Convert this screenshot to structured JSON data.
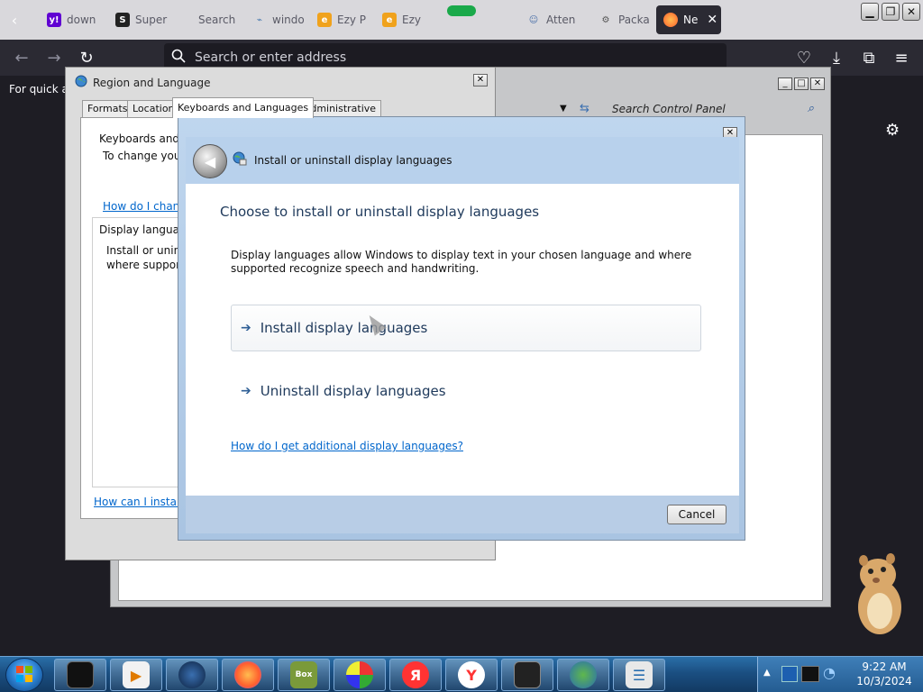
{
  "browser": {
    "tabs": [
      {
        "label": "down",
        "icon": "yahoo-icon"
      },
      {
        "label": "Super",
        "icon": "superuser-icon"
      },
      {
        "label": "Search",
        "icon": "search-tab-icon"
      },
      {
        "label": "windo",
        "icon": "wikihow-icon"
      },
      {
        "label": "Ezy P",
        "icon": "ezy-icon"
      },
      {
        "label": "Ezy",
        "icon": "ezy-icon"
      },
      {
        "label": "Atten",
        "icon": "people-icon"
      },
      {
        "label": "Packa",
        "icon": "package-icon"
      },
      {
        "label": "Ne",
        "icon": "firefox-icon"
      }
    ],
    "url_placeholder": "Search or enter address",
    "quick_access_text": "For quick ac"
  },
  "control_panel": {
    "search_placeholder": "Search Control Panel"
  },
  "region_dialog": {
    "title": "Region and Language",
    "tabs": [
      "Formats",
      "Location",
      "Keyboards and Languages",
      "Administrative"
    ],
    "keyboards_heading": "Keyboards and o",
    "keyboards_text": "To change your",
    "keyboards_link": "How do I chang",
    "display_heading": "Display language",
    "display_text_1": "Install or uninst",
    "display_text_2": "where supporte",
    "bottom_link": "How can I install a"
  },
  "install_dialog": {
    "title": "Install or uninstall display languages",
    "heading": "Choose to install or uninstall display languages",
    "description": "Display languages allow Windows to display text in your chosen language and where supported recognize speech and handwriting.",
    "option_install": "Install display languages",
    "option_uninstall": "Uninstall display languages",
    "help_link": "How do I get additional display languages?",
    "cancel": "Cancel"
  },
  "taskbar": {
    "time": "9:22 AM",
    "date": "10/3/2024",
    "items": [
      "terminal",
      "media-player",
      "globe",
      "firefox",
      "box-game",
      "color-wheel",
      "yandex",
      "yandex-browser",
      "screen",
      "network",
      "control-panel"
    ]
  }
}
